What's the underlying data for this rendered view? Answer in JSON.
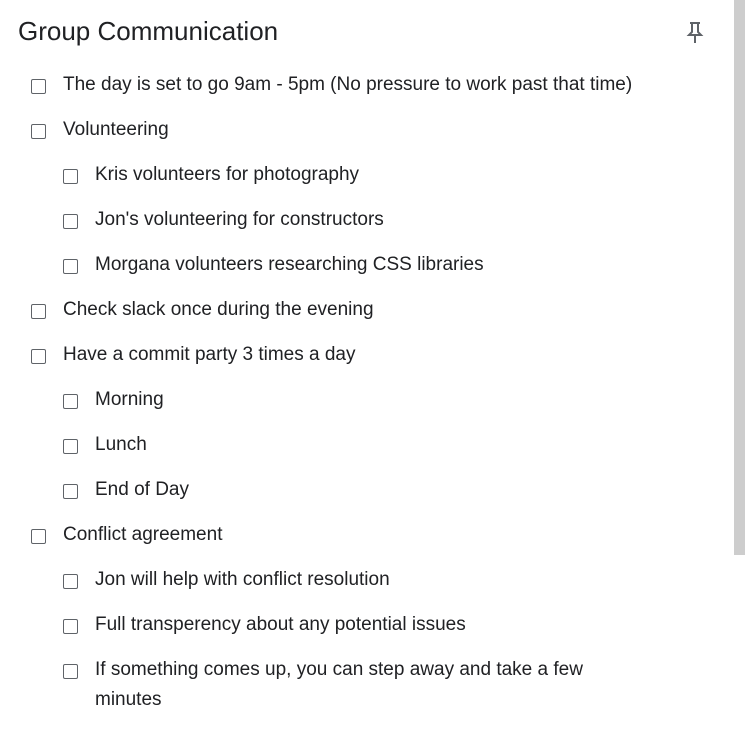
{
  "note": {
    "title": "Group Communication",
    "pin_icon": "pin-icon",
    "items": [
      {
        "text": "The day is set to go 9am - 5pm (No pressure to work past that time)",
        "level": 0,
        "checked": false
      },
      {
        "text": "Volunteering",
        "level": 0,
        "checked": false
      },
      {
        "text": "Kris volunteers for photography",
        "level": 1,
        "checked": false
      },
      {
        "text": "Jon's volunteering for constructors",
        "level": 1,
        "checked": false
      },
      {
        "text": "Morgana volunteers researching CSS libraries",
        "level": 1,
        "checked": false
      },
      {
        "text": "Check slack once during the evening",
        "level": 0,
        "checked": false
      },
      {
        "text": "Have a commit party 3 times a day",
        "level": 0,
        "checked": false
      },
      {
        "text": "Morning",
        "level": 1,
        "checked": false
      },
      {
        "text": "Lunch",
        "level": 1,
        "checked": false
      },
      {
        "text": "End of Day",
        "level": 1,
        "checked": false
      },
      {
        "text": "Conflict agreement",
        "level": 0,
        "checked": false
      },
      {
        "text": "Jon will help with conflict resolution",
        "level": 1,
        "checked": false
      },
      {
        "text": "Full transperency about any potential issues",
        "level": 1,
        "checked": false
      },
      {
        "text": "If something comes up, you can step away and take a few minutes",
        "level": 1,
        "checked": false
      }
    ]
  }
}
